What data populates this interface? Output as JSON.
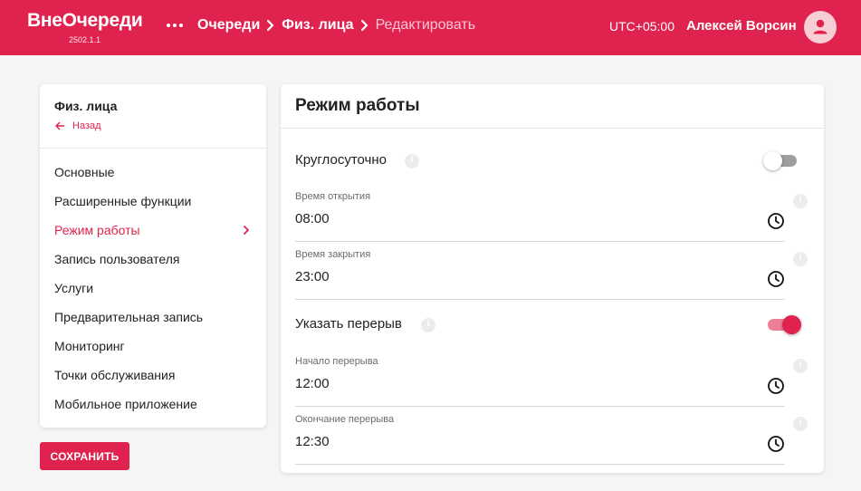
{
  "header": {
    "logo": "ВнеОчереди",
    "version": "2502.1.1",
    "breadcrumbs": [
      {
        "label": "Очереди"
      },
      {
        "label": "Физ. лица"
      },
      {
        "label": "Редактировать"
      }
    ],
    "timezone": "UTC+05:00",
    "user_name": "Алексей Ворсин",
    "icons": {
      "menu": "more-horizontal-icon",
      "avatar": "person-icon"
    }
  },
  "sidebar": {
    "title": "Физ. лица",
    "back_label": "Назад",
    "items": [
      {
        "label": "Основные",
        "active": false
      },
      {
        "label": "Расширенные функции",
        "active": false
      },
      {
        "label": "Режим работы",
        "active": true
      },
      {
        "label": "Запись пользователя",
        "active": false
      },
      {
        "label": "Услуги",
        "active": false
      },
      {
        "label": "Предварительная запись",
        "active": false
      },
      {
        "label": "Мониторинг",
        "active": false
      },
      {
        "label": "Точки обслуживания",
        "active": false
      },
      {
        "label": "Мобильное приложение",
        "active": false
      }
    ],
    "save_label": "СОХРАНИТЬ"
  },
  "main": {
    "title": "Режим работы",
    "around_the_clock": {
      "label": "Круглосуточно",
      "enabled": false
    },
    "open_time": {
      "label": "Время открытия",
      "value": "08:00"
    },
    "close_time": {
      "label": "Время закрытия",
      "value": "23:00"
    },
    "break_toggle": {
      "label": "Указать перерыв",
      "enabled": true
    },
    "break_start": {
      "label": "Начало перерыва",
      "value": "12:00"
    },
    "break_end": {
      "label": "Окончание перерыва",
      "value": "12:30"
    }
  },
  "colors": {
    "accent": "#e0234e",
    "header_bg": "#e0234e",
    "page_bg": "#f5f5f5",
    "switch_on_track": "#ee7d96"
  }
}
